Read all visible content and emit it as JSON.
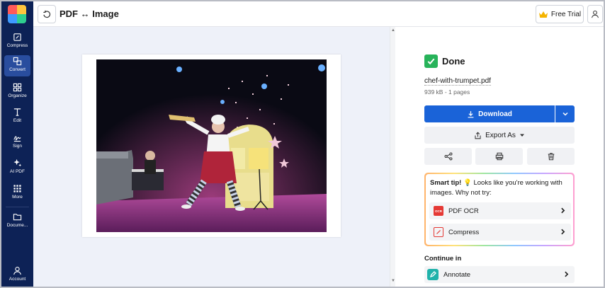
{
  "header": {
    "title": "PDF ↔ Image",
    "free_trial_label": "Free Trial"
  },
  "sidebar": {
    "items": [
      {
        "label": "Compress",
        "icon": "compress-icon"
      },
      {
        "label": "Convert",
        "icon": "convert-icon",
        "active": true
      },
      {
        "label": "Organize",
        "icon": "organize-icon"
      },
      {
        "label": "Edit",
        "icon": "edit-icon"
      },
      {
        "label": "Sign",
        "icon": "sign-icon"
      },
      {
        "label": "AI PDF",
        "icon": "ai-pdf-icon"
      },
      {
        "label": "More",
        "icon": "more-icon"
      },
      {
        "label": "Docume...",
        "icon": "documents-icon"
      },
      {
        "label": "Account",
        "icon": "account-icon"
      }
    ]
  },
  "panel": {
    "status": "Done",
    "file_name": "chef-with-trumpet.pdf",
    "file_meta": "939 kB - 1 pages",
    "download_label": "Download",
    "export_label": "Export As",
    "tip": {
      "lead": "Smart tip!",
      "emoji": "💡",
      "text": " Looks like you're working with images. Why not try:",
      "items": [
        {
          "label": "PDF OCR",
          "badge": "OCR"
        },
        {
          "label": "Compress"
        }
      ]
    },
    "continue_label": "Continue in",
    "continue_items": [
      {
        "label": "Annotate"
      }
    ]
  },
  "colors": {
    "sidebar_bg": "#0d2256",
    "primary": "#1a63d8",
    "success": "#27b35a"
  }
}
